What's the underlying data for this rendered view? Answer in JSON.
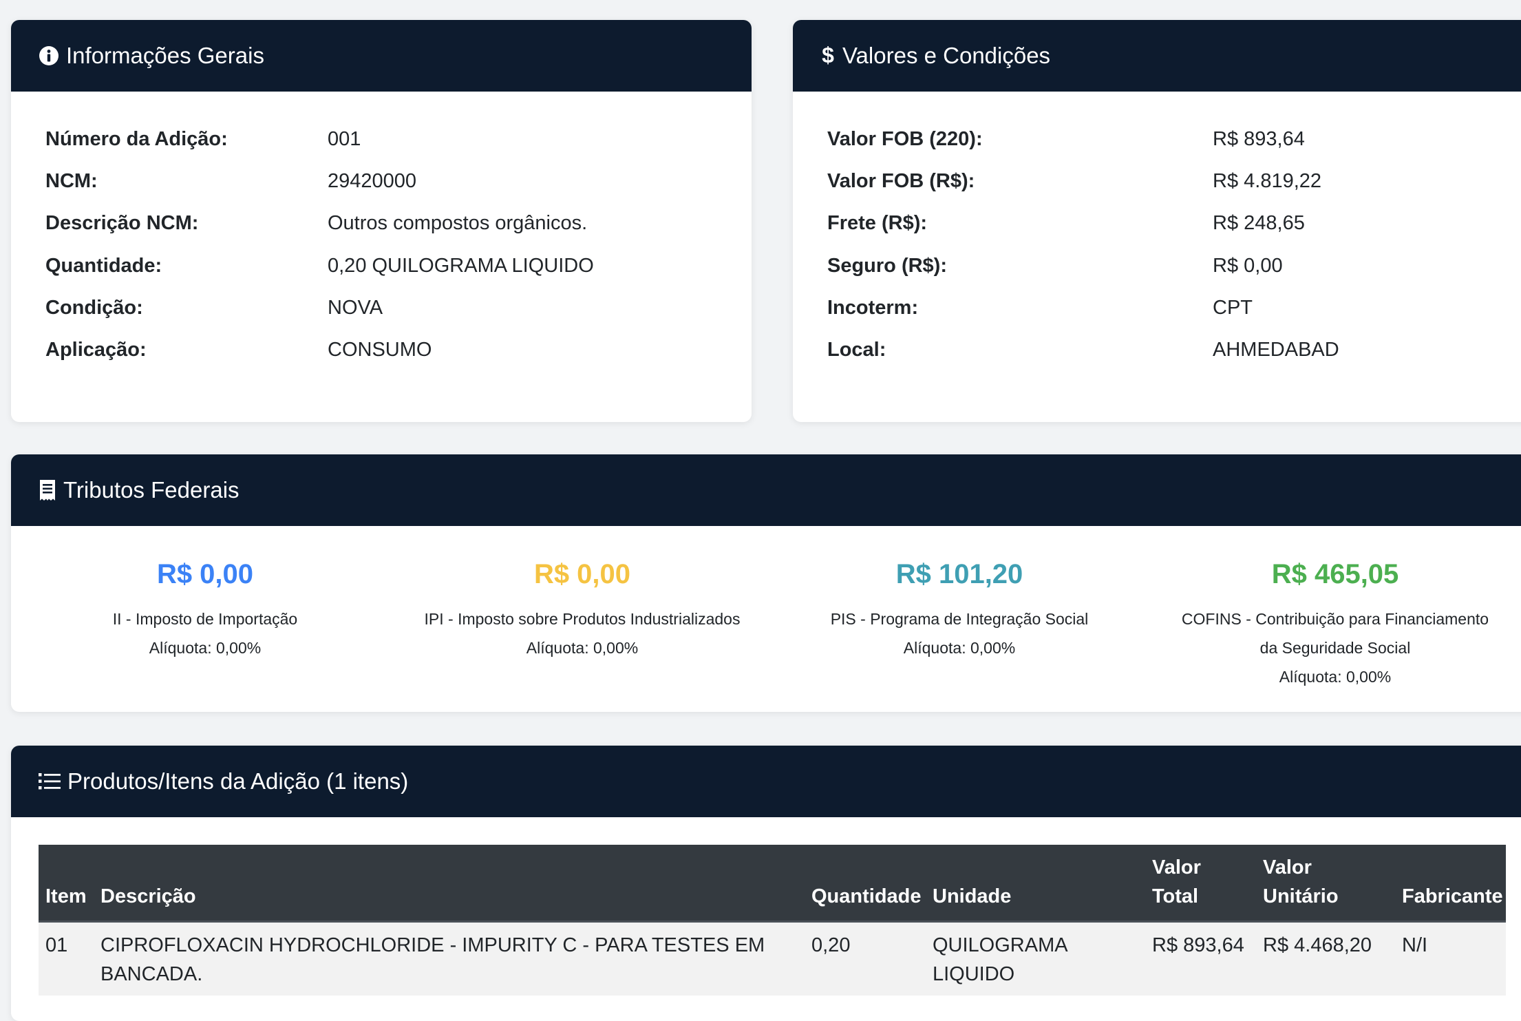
{
  "info": {
    "title": "Informações Gerais",
    "icon": "info-circle-icon",
    "rows": [
      {
        "label": "Número da Adição:",
        "value": "001"
      },
      {
        "label": "NCM:",
        "value": "29420000"
      },
      {
        "label": "Descrição NCM:",
        "value": "Outros compostos orgânicos."
      },
      {
        "label": "Quantidade:",
        "value": "0,20 QUILOGRAMA LIQUIDO"
      },
      {
        "label": "Condição:",
        "value": "NOVA"
      },
      {
        "label": "Aplicação:",
        "value": "CONSUMO"
      }
    ]
  },
  "valores": {
    "title": "Valores e Condições",
    "icon": "dollar-icon",
    "rows": [
      {
        "label": "Valor FOB (220):",
        "value": "R$ 893,64"
      },
      {
        "label": "Valor FOB (R$):",
        "value": "R$ 4.819,22"
      },
      {
        "label": "Frete (R$):",
        "value": "R$ 248,65"
      },
      {
        "label": "Seguro (R$):",
        "value": "R$ 0,00"
      },
      {
        "label": "Incoterm:",
        "value": "CPT"
      },
      {
        "label": "Local:",
        "value": "AHMEDABAD"
      }
    ]
  },
  "tributos": {
    "title": "Tributos Federais",
    "icon": "receipt-icon",
    "items": [
      {
        "amount": "R$ 0,00",
        "name": "II - Imposto de Importação",
        "aliquota": "Alíquota: 0,00%",
        "color": "#3b82f6"
      },
      {
        "amount": "R$ 0,00",
        "name": "IPI - Imposto sobre Produtos Industrializados",
        "aliquota": "Alíquota: 0,00%",
        "color": "#f5c342"
      },
      {
        "amount": "R$ 101,20",
        "name": "PIS - Programa de Integração Social",
        "aliquota": "Alíquota: 0,00%",
        "color": "#3f9fb3"
      },
      {
        "amount": "R$ 465,05",
        "name_line1": "COFINS - Contribuição para Financiamento",
        "name_line2": "da Seguridade Social",
        "aliquota": "Alíquota: 0,00%",
        "color": "#4caf50"
      }
    ]
  },
  "produtos": {
    "title": "Produtos/Itens da Adição (1 itens)",
    "icon": "list-icon",
    "headers": {
      "item": "Item",
      "descricao": "Descrição",
      "quantidade": "Quantidade",
      "unidade": "Unidade",
      "valor_total_1": "Valor",
      "valor_total_2": "Total",
      "valor_unitario_1": "Valor",
      "valor_unitario_2": "Unitário",
      "fabricante": "Fabricante"
    },
    "rows": [
      {
        "item": "01",
        "descricao_1": "CIPROFLOXACIN HYDROCHLORIDE - IMPURITY C - PARA TESTES EM",
        "descricao_2": "BANCADA.",
        "quantidade": "0,20",
        "unidade_1": "QUILOGRAMA",
        "unidade_2": "LIQUIDO",
        "valor_total": "R$ 893,64",
        "valor_unitario": "R$ 4.468,20",
        "fabricante": "N/I"
      }
    ]
  }
}
